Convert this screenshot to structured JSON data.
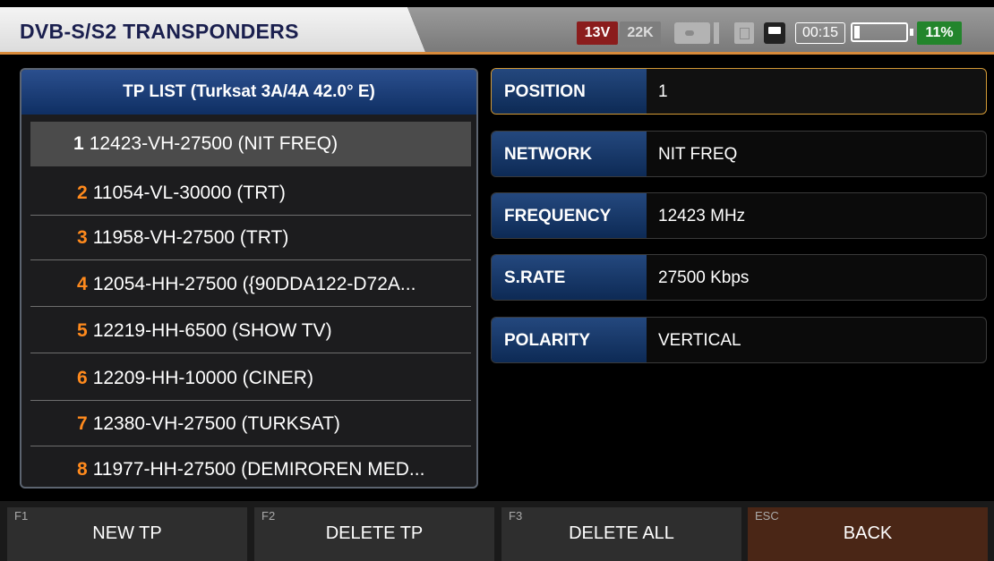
{
  "header": {
    "title": "DVB-S/S2 TRANSPONDERS",
    "voltage": "13V",
    "tone": "22K",
    "time": "00:15",
    "battery_pct": "11%",
    "battery_level": 0.11,
    "icons": [
      "lnb-icon",
      "card-icon",
      "chat-icon",
      "battery-icon"
    ]
  },
  "tp_list": {
    "title": "TP LIST (Turksat 3A/4A 42.0° E)",
    "items": [
      {
        "num": "1",
        "label": "12423-VH-27500 (NIT FREQ)"
      },
      {
        "num": "2",
        "label": "11054-VL-30000 (TRT)"
      },
      {
        "num": "3",
        "label": "11958-VH-27500 (TRT)"
      },
      {
        "num": "4",
        "label": "12054-HH-27500 ({90DDA122-D72A..."
      },
      {
        "num": "5",
        "label": "12219-HH-6500 (SHOW TV)"
      },
      {
        "num": "6",
        "label": "12209-HH-10000 (CINER)"
      },
      {
        "num": "7",
        "label": "12380-VH-27500 (TURKSAT)"
      },
      {
        "num": "8",
        "label": "11977-HH-27500 (DEMIROREN MED..."
      }
    ]
  },
  "details": {
    "position": {
      "label": "POSITION",
      "value": "1"
    },
    "network": {
      "label": "NETWORK",
      "value": "NIT FREQ"
    },
    "frequency": {
      "label": "FREQUENCY",
      "value": "12423 MHz"
    },
    "srate": {
      "label": "S.RATE",
      "value": "27500 Kbps"
    },
    "polarity": {
      "label": "POLARITY",
      "value": "VERTICAL"
    }
  },
  "footer": {
    "f1_key": "F1",
    "f1_label": "NEW TP",
    "f2_key": "F2",
    "f2_label": "DELETE TP",
    "f3_key": "F3",
    "f3_label": "DELETE ALL",
    "esc_key": "ESC",
    "esc_label": "BACK"
  },
  "colors": {
    "accent_orange": "#ff8a1d",
    "header_blue": "#1a1f4e",
    "voltage_red": "#8b1d1d",
    "battery_green": "#23852c"
  }
}
